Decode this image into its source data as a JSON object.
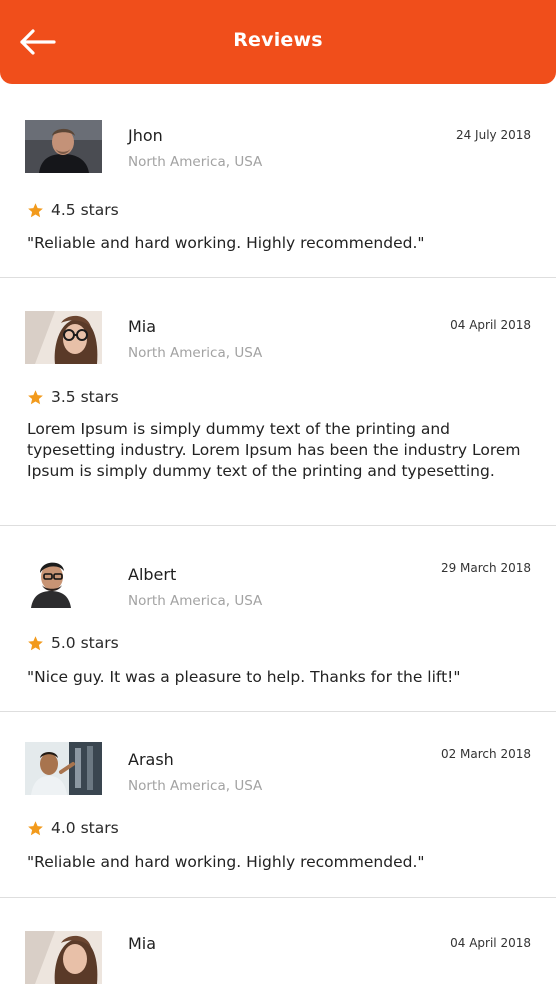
{
  "header": {
    "title": "Reviews",
    "back_icon": "arrow-left-icon",
    "bg_color": "#f04e1b"
  },
  "accent": {
    "star_color": "#f29a1c"
  },
  "reviews": [
    {
      "name": "Jhon",
      "location": "North America, USA",
      "date": "24 July 2018",
      "rating": "4.5 stars",
      "text": "\"Reliable and hard working. Highly recommended.\""
    },
    {
      "name": "Mia",
      "location": "North America, USA",
      "date": "04 April 2018",
      "rating": "3.5 stars",
      "text": "Lorem Ipsum is simply dummy text of the printing and typesetting industry. Lorem Ipsum has been the industry Lorem Ipsum is simply dummy text of the printing and typesetting."
    },
    {
      "name": "Albert",
      "location": "North America, USA",
      "date": "29 March 2018",
      "rating": "5.0 stars",
      "text": "\"Nice guy. It was a pleasure to help. Thanks for the lift!\""
    },
    {
      "name": "Arash",
      "location": "North America, USA",
      "date": "02 March 2018",
      "rating": "4.0 stars",
      "text": "\"Reliable and hard working. Highly recommended.\""
    },
    {
      "name": "Mia",
      "date": "04 April 2018"
    }
  ]
}
